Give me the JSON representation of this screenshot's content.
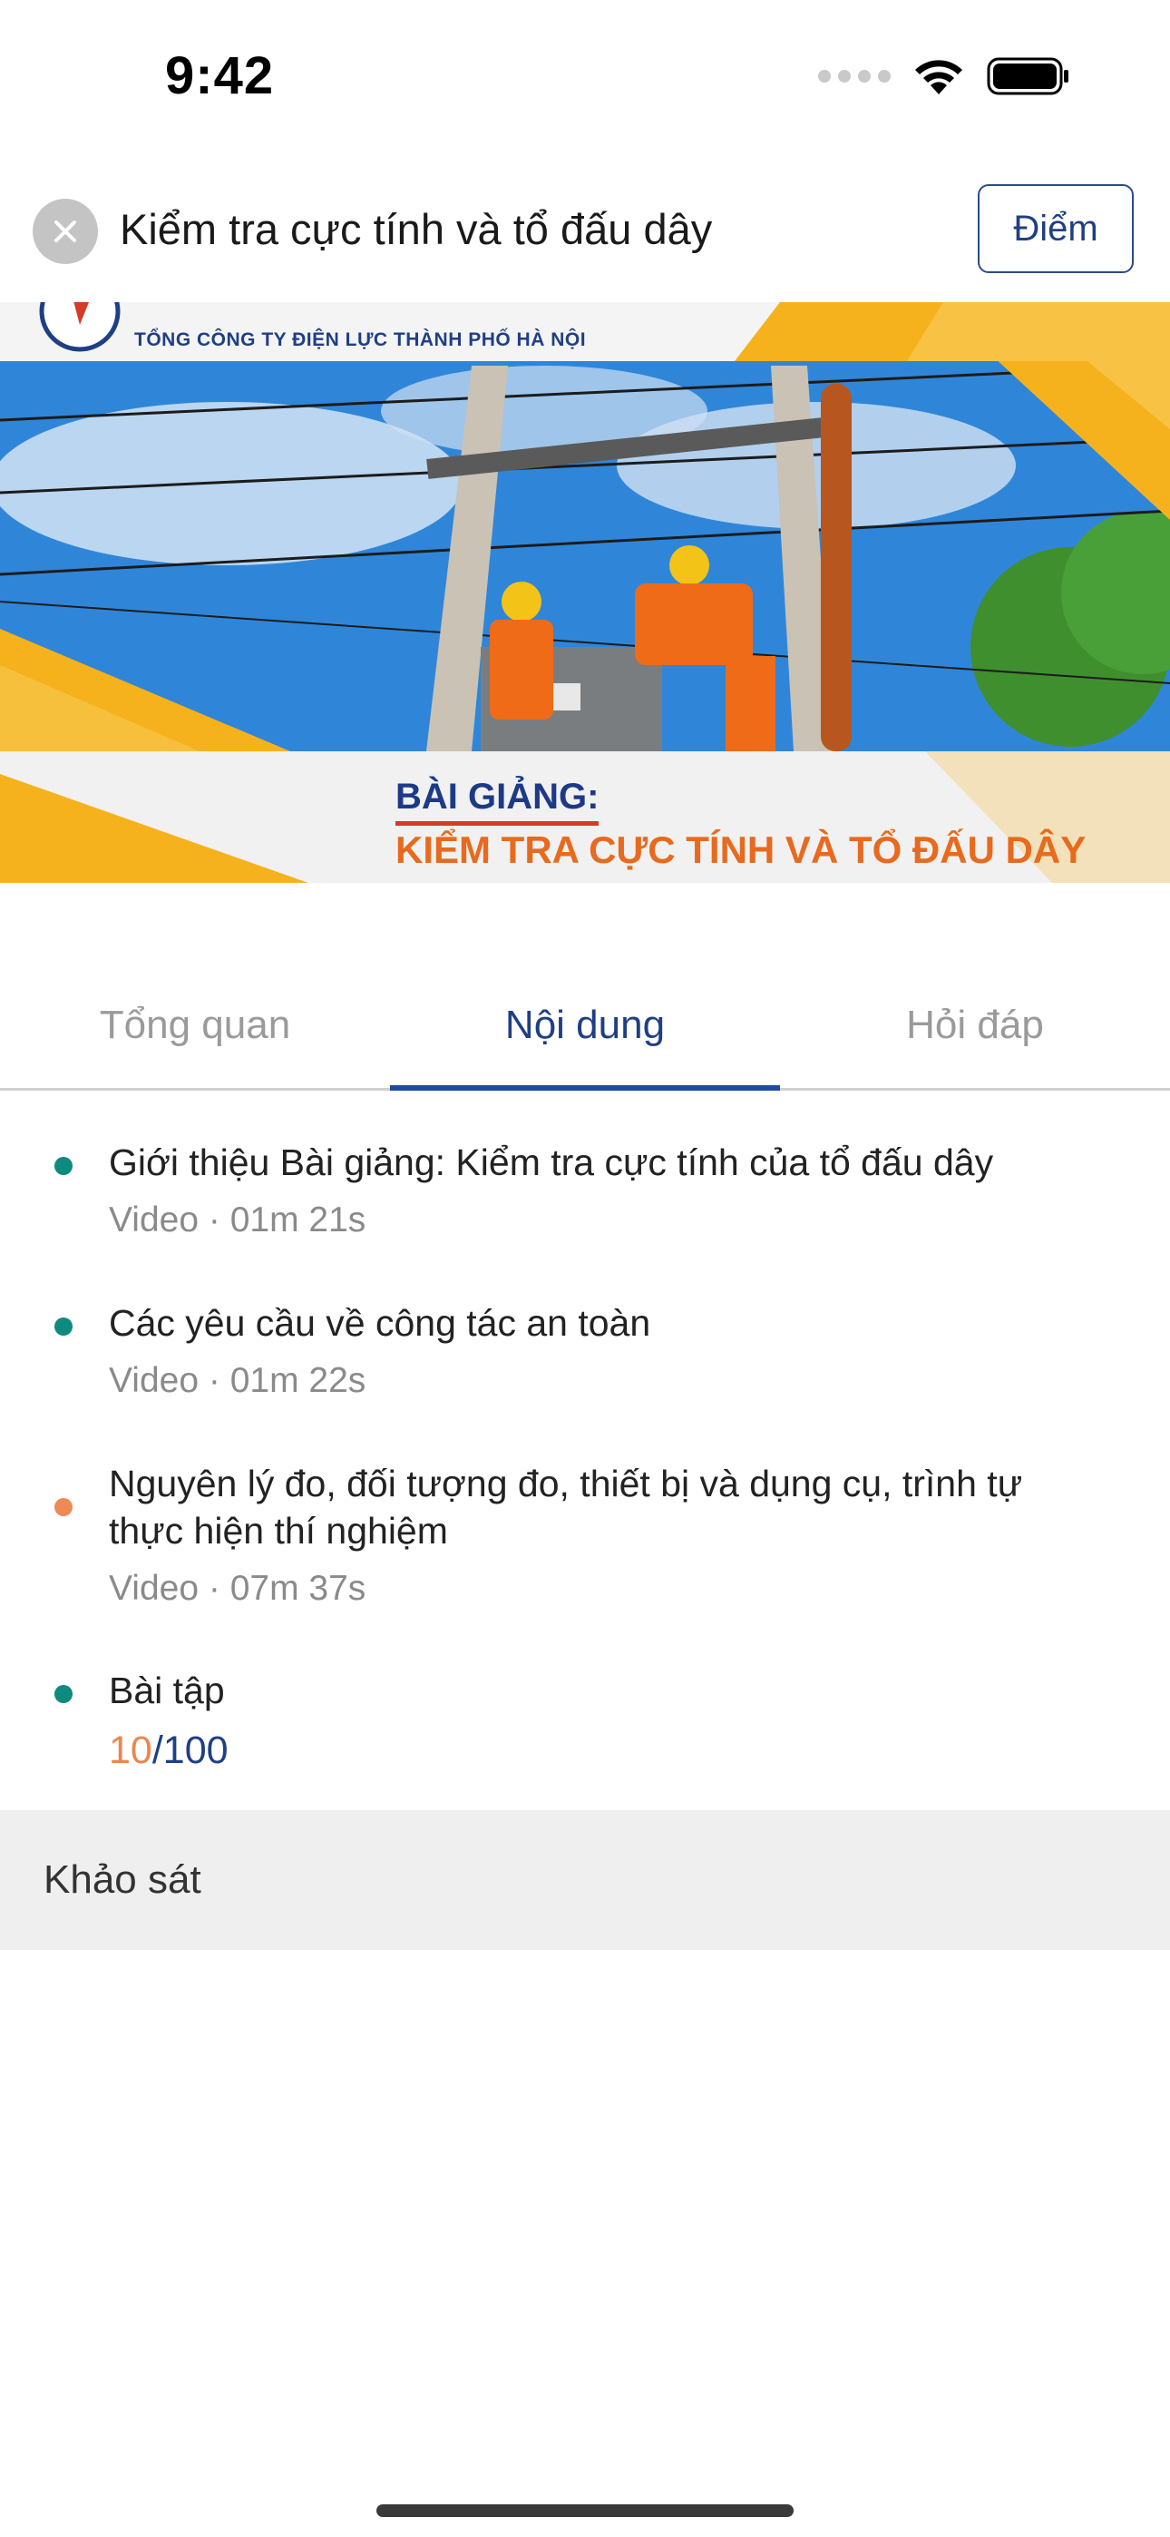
{
  "status_bar": {
    "time": "9:42",
    "icons": [
      "signal-icon",
      "wifi-icon",
      "battery-icon"
    ]
  },
  "header": {
    "title": "Kiểm tra cực tính và tổ đấu dây",
    "score_button": "Điểm",
    "close_icon": "close-icon"
  },
  "banner": {
    "org_name": "TỔNG CÔNG TY ĐIỆN LỰC THÀNH PHỐ HÀ NỘI",
    "heading": "BÀI GIẢNG:",
    "subheading": "KIỂM TRA CỰC TÍNH VÀ TỔ ĐẤU DÂY"
  },
  "tabs": [
    {
      "label": "Tổng quan",
      "active": false
    },
    {
      "label": "Nội dung",
      "active": true
    },
    {
      "label": "Hỏi đáp",
      "active": false
    }
  ],
  "lessons": [
    {
      "title": "Giới thiệu Bài giảng: Kiểm tra cực tính của tổ đấu dây",
      "meta": "Video · 01m 21s",
      "status_color": "#0f8a7e"
    },
    {
      "title": "Các yêu cầu về công tác an toàn",
      "meta": "Video · 01m 22s",
      "status_color": "#0f8a7e"
    },
    {
      "title": "Nguyên lý đo, đối tượng đo, thiết bị và dụng cụ, trình tự thực hiện thí nghiệm",
      "meta": "Video · 07m 37s",
      "status_color": "#ee8a55"
    },
    {
      "title": "Bài tập",
      "score": "10",
      "separator": "/",
      "total": "100",
      "status_color": "#0f8a7e"
    }
  ],
  "survey": {
    "label": "Khảo sát"
  },
  "colors": {
    "primary": "#1f3f85",
    "accent_orange": "#e9874f",
    "done_teal": "#0f8a7e",
    "banner_yellow": "#f6b21c"
  }
}
